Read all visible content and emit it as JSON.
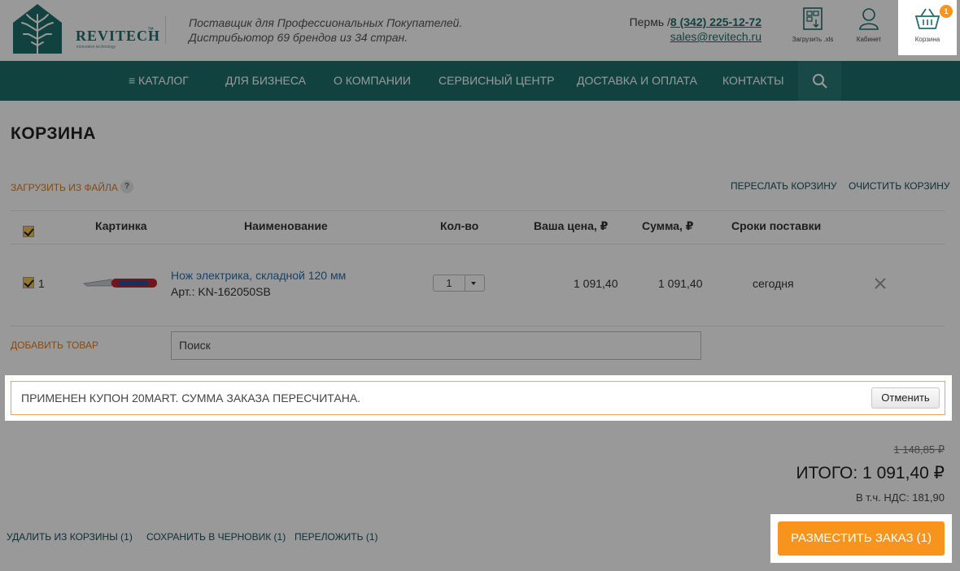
{
  "brand": {
    "name": "REVITECH",
    "tm": "™",
    "subtitle": "innovative technology"
  },
  "tagline": {
    "line1": "Поставщик для Профессиональных Покупателей.",
    "line2": "Дистрибьютор 69 брендов из 34 стран."
  },
  "contact": {
    "city": "Пермь",
    "sep": "/",
    "phone": "8 (342) 225-12-72",
    "email": "sales@revitech.ru"
  },
  "header_buttons": {
    "upload": "Загрузить .xls",
    "cabinet": "Кабинет",
    "cart": "Корзина",
    "cart_count": "1"
  },
  "nav": {
    "items": [
      "≡ КАТАЛОГ",
      "ДЛЯ БИЗНЕСА",
      "О КОМПАНИИ",
      "СЕРВИСНЫЙ ЦЕНТР",
      "ДОСТАВКА И ОПЛАТА",
      "КОНТАКТЫ"
    ]
  },
  "page": {
    "title": "КОРЗИНА",
    "upload_from_file": "ЗАГРУЗИТЬ ИЗ ФАЙЛА",
    "help": "?",
    "forward_cart": "ПЕРЕСЛАТЬ КОРЗИНУ",
    "clear_cart": "ОЧИСТИТЬ КОРЗИНУ"
  },
  "table": {
    "headers": [
      "Картинка",
      "Наименование",
      "Кол-во",
      "Ваша цена, ₽",
      "Сумма, ₽",
      "Сроки поставки"
    ],
    "rows": [
      {
        "num": "1",
        "name": "Нож электрика, складной 120 мм",
        "sku": "Арт.: KN-162050SB",
        "qty": "1",
        "price": "1 091,40",
        "sum": "1 091,40",
        "delivery": "сегодня"
      }
    ]
  },
  "add_product": {
    "label": "ДОБАВИТЬ ТОВАР",
    "placeholder": "Поиск"
  },
  "coupon": {
    "message": "ПРИМЕНЕН КУПОН 20MART. СУММА ЗАКАЗА ПЕРЕСЧИТАНА.",
    "cancel": "Отменить"
  },
  "totals": {
    "old": "1 148,85 ₽",
    "total": "ИТОГО: 1 091,40 ₽",
    "vat": "В т.ч. НДС: 181,90"
  },
  "actions": {
    "delete": "УДАЛИТЬ ИЗ КОРЗИНЫ (1)",
    "draft": "СОХРАНИТЬ В ЧЕРНОВИК (1)",
    "move": "ПЕРЕЛОЖИТЬ (1)",
    "order": "РАЗМЕСТИТЬ ЗАКАЗ (1)"
  },
  "colors": {
    "brand": "#1f6e6a",
    "accent": "#f7941d",
    "link": "#2b6fa8"
  }
}
